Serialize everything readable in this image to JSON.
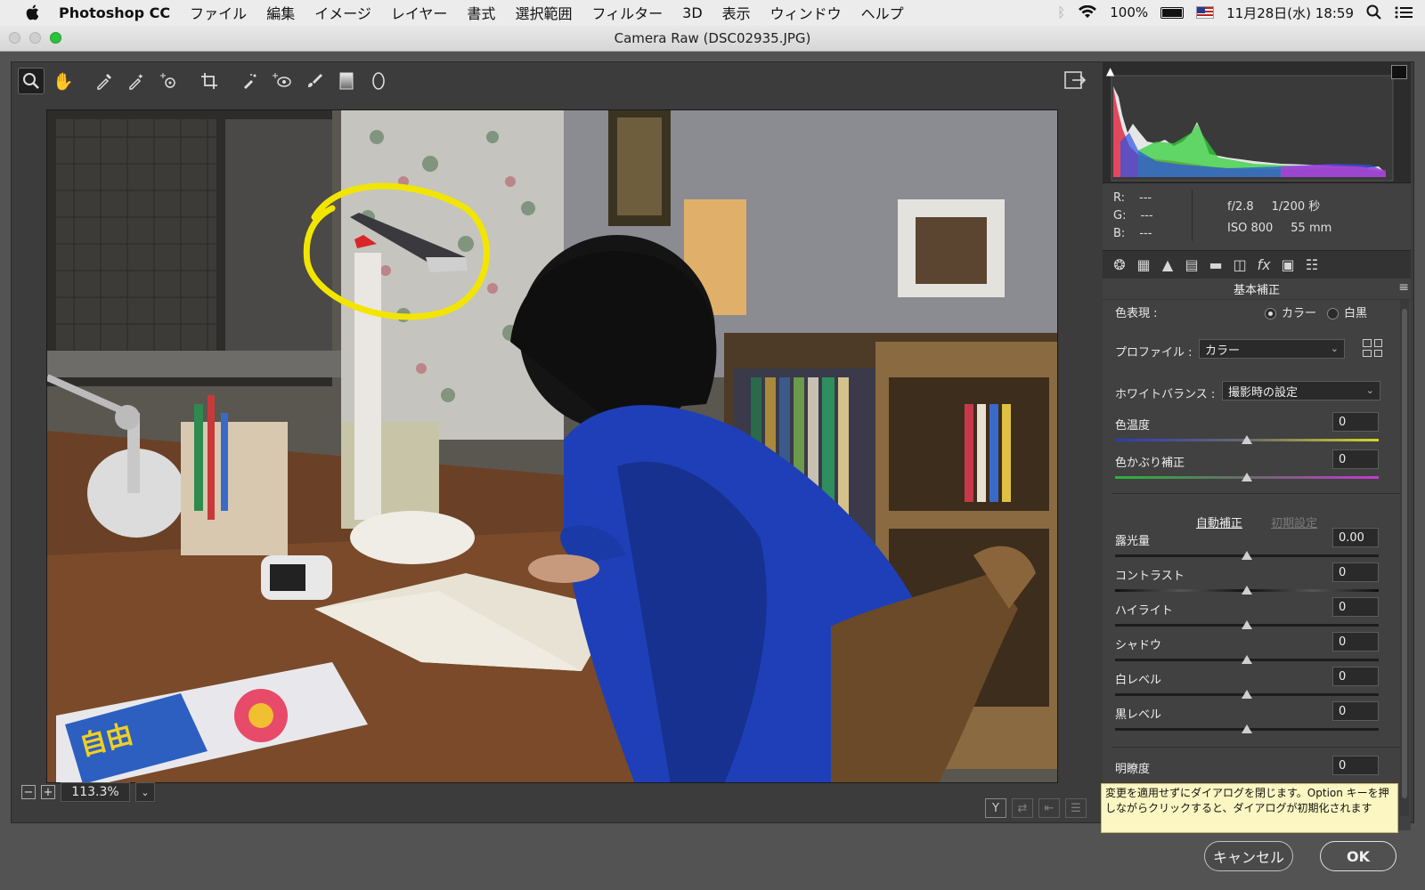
{
  "menubar": {
    "app_name": "Photoshop CC",
    "items": [
      "ファイル",
      "編集",
      "イメージ",
      "レイヤー",
      "書式",
      "選択範囲",
      "フィルター",
      "3D",
      "表示",
      "ウィンドウ",
      "ヘルプ"
    ],
    "battery": "100%",
    "datetime": "11月28日(水)  18:59"
  },
  "window": {
    "title": "Camera Raw (DSC02935.JPG)"
  },
  "toolbar": {
    "tools": [
      "zoom-icon",
      "hand-icon",
      "white-balance-icon",
      "color-sampler-icon",
      "targeted-adjustment-icon",
      "crop-icon",
      "spot-removal-icon",
      "red-eye-icon",
      "adjustment-brush-icon",
      "graduated-filter-icon",
      "radial-filter-icon"
    ],
    "export_icon": "open-preferences-icon"
  },
  "preview": {
    "zoom_level": "113.3%"
  },
  "histogram": {
    "rgb": {
      "r_label": "R:",
      "r_value": "---",
      "g_label": "G:",
      "g_value": "---",
      "b_label": "B:",
      "b_value": "---"
    },
    "exif": {
      "aperture": "f/2.8",
      "shutter": "1/200 秒",
      "iso": "ISO 800",
      "focal": "55 mm"
    }
  },
  "panel": {
    "section_title": "基本補正",
    "treatment_label": "色表現 :",
    "treatment_color": "カラー",
    "treatment_bw": "白黒",
    "profile_label": "プロファイル :",
    "profile_value": "カラー",
    "wb_label": "ホワイトバランス :",
    "wb_value": "撮影時の設定",
    "auto_label": "自動補正",
    "defaults_label": "初期設定",
    "sliders": [
      {
        "label": "色温度",
        "value": "0",
        "position": 0.5
      },
      {
        "label": "色かぶり補正",
        "value": "0",
        "position": 0.5
      },
      {
        "label": "露光量",
        "value": "0.00",
        "position": 0.5
      },
      {
        "label": "コントラスト",
        "value": "0",
        "position": 0.5
      },
      {
        "label": "ハイライト",
        "value": "0",
        "position": 0.5
      },
      {
        "label": "シャドウ",
        "value": "0",
        "position": 0.5
      },
      {
        "label": "白レベル",
        "value": "0",
        "position": 0.5
      },
      {
        "label": "黒レベル",
        "value": "0",
        "position": 0.5
      },
      {
        "label": "明瞭度",
        "value": "0",
        "position": 0.5
      }
    ]
  },
  "tooltip": {
    "text": "変更を適用せずにダイアログを閉じます。Option キーを押しながらクリックすると、ダイアログが初期化されます"
  },
  "buttons": {
    "cancel": "キャンセル",
    "ok": "OK"
  },
  "colors": {
    "annotation": "#f2e600",
    "shirt": "#1f3fb8"
  }
}
